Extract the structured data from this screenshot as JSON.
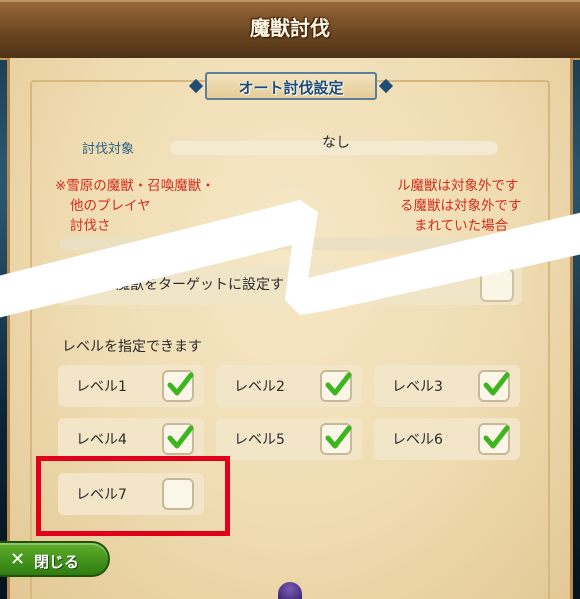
{
  "window": {
    "title": "魔獣討伐"
  },
  "section": {
    "title": "オート討伐設定"
  },
  "target": {
    "label": "討伐対象",
    "value": "なし"
  },
  "warnings": [
    "※雪原の魔獣・召喚魔獣・",
    "ル魔獣は対象外です",
    "他のプレイヤ",
    "る魔獣は対象外です",
    "討伐さ",
    "まれていた場合"
  ],
  "all_target": {
    "label": "ての魔獣をターゲットに設定す",
    "checked": false
  },
  "levels_caption": "レベルを指定できます",
  "levels": [
    {
      "label": "レベル1",
      "checked": true
    },
    {
      "label": "レベル2",
      "checked": true
    },
    {
      "label": "レベル3",
      "checked": true
    },
    {
      "label": "レベル4",
      "checked": true
    },
    {
      "label": "レベル5",
      "checked": true
    },
    {
      "label": "レベル6",
      "checked": true
    },
    {
      "label": "レベル7",
      "checked": false
    }
  ],
  "close_button": {
    "label": "閉じる"
  },
  "colors": {
    "check": "#3db51e",
    "highlight": "#e0001b",
    "warning": "#d52c1b"
  }
}
